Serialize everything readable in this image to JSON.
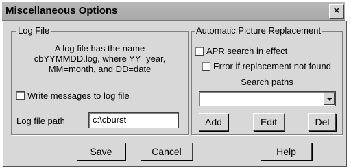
{
  "window": {
    "title": "Miscellaneous Options",
    "close_label": "×"
  },
  "log_file": {
    "group_title": "Log File",
    "info_lines": [
      "A log file has the name",
      "cbYYMMDD.log, where YY=year,",
      "MM=month, and DD=date"
    ],
    "write_checkbox_label": "Write messages to log file",
    "write_checked": false,
    "path_label": "Log file path",
    "path_value": "c:\\cburst"
  },
  "apr": {
    "group_title": "Automatic Picture Replacement",
    "search_checkbox_label": "APR search in effect",
    "search_checked": false,
    "error_checkbox_label": "Error if replacement not found",
    "error_checked": false,
    "search_paths_label": "Search paths",
    "search_paths_value": "",
    "buttons": {
      "add": "Add",
      "edit": "Edit",
      "del": "Del"
    }
  },
  "footer": {
    "save": "Save",
    "cancel": "Cancel",
    "help": "Help"
  }
}
